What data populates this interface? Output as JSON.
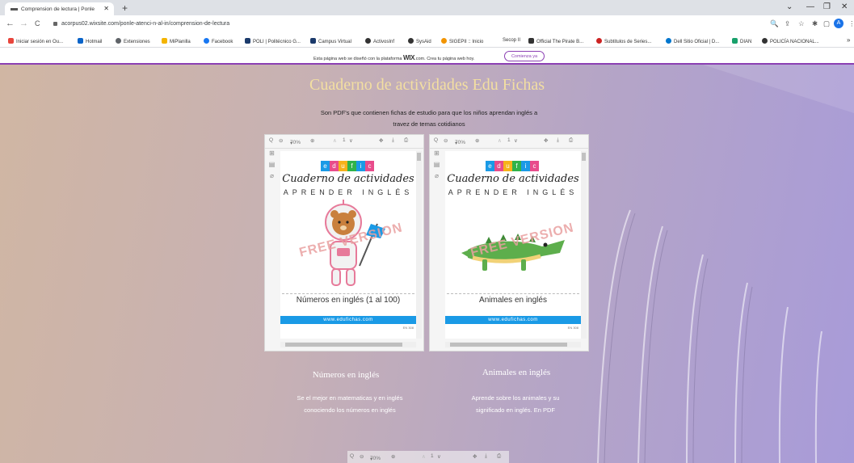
{
  "browser": {
    "tab_title": "Comprension de lectura | Ponle",
    "tab_close": "✕",
    "new_tab": "+",
    "minimize": "—",
    "restore": "❐",
    "close": "✕",
    "chevron": "⌄",
    "back": "←",
    "forward": "→",
    "reload": "C",
    "url": "acorpus02.wixsite.com/ponle-atenci-n-al-in/comprension-de-lectura",
    "profile_initial": "A",
    "menu": "⋮",
    "right_icons": [
      "🔍",
      "⇪",
      "☆",
      "✱",
      "▢"
    ]
  },
  "bookmarks": [
    {
      "label": "Iniciar sesión en Ou...",
      "color": "#e8453c"
    },
    {
      "label": "Hotmail",
      "color": "#0a64c9"
    },
    {
      "label": "Extensiones",
      "color": "#5f6368"
    },
    {
      "label": "MiPlanilla",
      "color": "#f4b400"
    },
    {
      "label": "Facebook",
      "color": "#1877f2"
    },
    {
      "label": "POLI | Politécnico G...",
      "color": "#1b3a6b"
    },
    {
      "label": "Campus Virtual",
      "color": "#1b3a6b"
    },
    {
      "label": "ActivosInf",
      "color": "#333333"
    },
    {
      "label": "SysAid",
      "color": "#333333"
    },
    {
      "label": "SIGEPII :: Inicio",
      "color": "#f29400"
    },
    {
      "label": "Secop II",
      "color": "#ffffff"
    },
    {
      "label": "Official The Pirate B...",
      "color": "#333333"
    },
    {
      "label": "Subtitulos de Series...",
      "color": "#cc2222"
    },
    {
      "label": "Dell Sitio Oficial | D...",
      "color": "#0076ce"
    },
    {
      "label": "DIAN",
      "color": "#18a06b"
    },
    {
      "label": "POLICÍA NACIONAL...",
      "color": "#333333"
    }
  ],
  "bookmarks_more": "»",
  "wix_banner": {
    "text_before": "Esta página web se diseñó con la plataforma",
    "brand": "WIX",
    "text_after": ".com. Crea tu página web hoy.",
    "button": "Comienza ya"
  },
  "page": {
    "title": "Cuaderno de actividades Edu Fichas",
    "subtitle": "Son PDF's que contienen fichas de estudio para que los niños aprendan inglés a travez de temas cotidianos"
  },
  "viewer_toolbar": {
    "search": "Q",
    "zoom_out": "⊖",
    "zoom": "70%",
    "zoom_caret": "▾",
    "zoom_in": "⊕",
    "page_up": "∧",
    "page": "1",
    "page_down": "∨",
    "pan": "✥",
    "download": "⤓",
    "print": "⎙"
  },
  "viewer_side": [
    "⊞",
    "▤",
    "⌀"
  ],
  "cards": [
    {
      "doc_logo": [
        "e",
        "d",
        "u",
        "f",
        "i",
        "c",
        "h",
        "a",
        "s"
      ],
      "doc_title_script": "Cuaderno de actividades",
      "doc_title_caps": "APRENDER INGLÉS",
      "watermark": "FREE VERSION",
      "doc_caption": "Números en inglés (1 al 100)",
      "doc_url": "www.edufichas.com",
      "doc_pagenum": "EN 308",
      "title": "Números en inglés",
      "description": "Se el mejor en matematicas y en inglés conociendo los números en inglés"
    },
    {
      "doc_logo": [
        "e",
        "d",
        "u",
        "f",
        "i",
        "c",
        "h",
        "a",
        "s"
      ],
      "doc_title_script": "Cuaderno de actividades",
      "doc_title_caps": "APRENDER INGLÉS",
      "watermark": "FREE VERSION",
      "doc_caption": "Animales en inglés",
      "doc_url": "www.edufichas.com",
      "doc_pagenum": "EN 308",
      "title": "Animales en inglés",
      "description": "Aprende sobre los animales y su significado en inglés. En PDF"
    }
  ],
  "logo_colors": [
    "#1a9ae6",
    "#e84c8b",
    "#f6b21a",
    "#2fb34a",
    "#1a9ae6",
    "#e84c8b",
    "#f6b21a",
    "#2fb34a",
    "#e84c3d"
  ]
}
